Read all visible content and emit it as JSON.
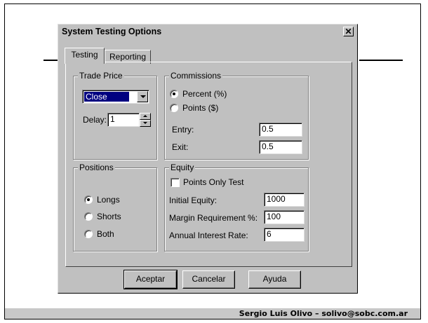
{
  "slide": {
    "footer_text": "Sergio Luis Olivo – solivo@sobc.com.ar"
  },
  "dialog": {
    "title": "System Testing Options",
    "close_icon": "close-icon",
    "tabs": [
      {
        "label": "Testing",
        "active": true
      },
      {
        "label": "Reporting",
        "active": false
      }
    ],
    "trade_price": {
      "legend": "Trade Price",
      "selected": "Close",
      "delay_label": "Delay:",
      "delay_value": "1"
    },
    "commissions": {
      "legend": "Commissions",
      "options": [
        {
          "label": "Percent (%)",
          "checked": true
        },
        {
          "label": "Points ($)",
          "checked": false
        }
      ],
      "entry_label": "Entry:",
      "entry_value": "0.5",
      "exit_label": "Exit:",
      "exit_value": "0.5"
    },
    "positions": {
      "legend": "Positions",
      "options": [
        {
          "label": "Longs",
          "checked": true
        },
        {
          "label": "Shorts",
          "checked": false
        },
        {
          "label": "Both",
          "checked": false
        }
      ]
    },
    "equity": {
      "legend": "Equity",
      "points_only_label": "Points Only Test",
      "points_only_checked": false,
      "initial_equity_label": "Initial Equity:",
      "initial_equity_value": "1000",
      "margin_label": "Margin Requirement %:",
      "margin_value": "100",
      "interest_label": "Annual Interest Rate:",
      "interest_value": "6"
    },
    "buttons": {
      "ok": "Aceptar",
      "cancel": "Cancelar",
      "help": "Ayuda"
    }
  }
}
